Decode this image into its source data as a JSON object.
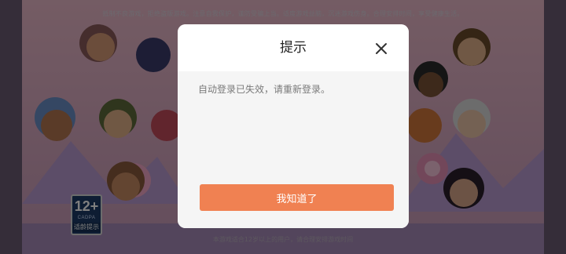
{
  "background": {
    "health_notice": "抵制不良游戏，拒绝盗版游戏。注意自我保护，谨防受骗上当。适度游戏益脑，沉迷游戏伤身。合理安排时间，享受健康生活。",
    "bottom_notice": "本游戏适合12岁以上的用户，请合理安排游戏时间",
    "age_rating": {
      "number": "12+",
      "sub": "CADPA",
      "caption": "适龄提示"
    }
  },
  "dialog": {
    "title": "提示",
    "message": "自动登录已失效，请重新登录。",
    "confirm_label": "我知道了",
    "close_icon": "close-icon"
  },
  "colors": {
    "accent": "#f08152",
    "overlay": "rgba(0,0,0,0.5)",
    "dialog_body": "#f5f5f5"
  }
}
